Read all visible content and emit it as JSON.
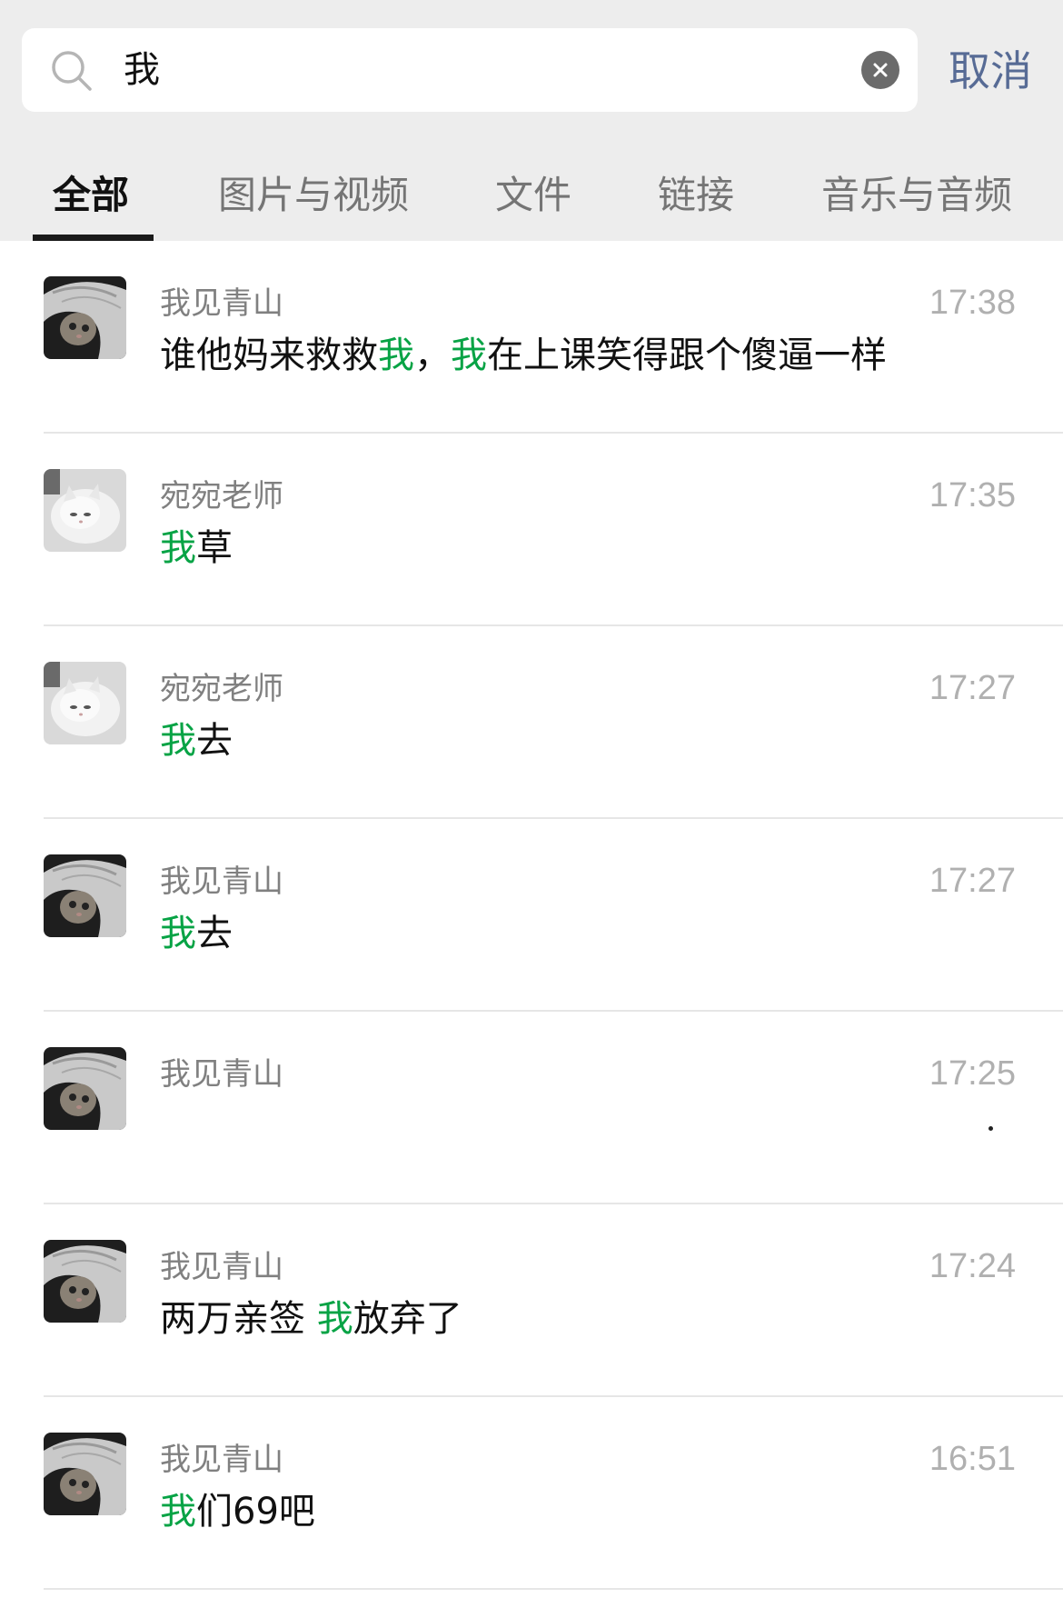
{
  "search": {
    "query": "我",
    "cancel_label": "取消"
  },
  "tabs": [
    {
      "label": "全部",
      "active": true
    },
    {
      "label": "图片与视频",
      "active": false
    },
    {
      "label": "文件",
      "active": false
    },
    {
      "label": "链接",
      "active": false
    },
    {
      "label": "音乐与音频",
      "active": false
    }
  ],
  "results": [
    {
      "sender": "我见青山",
      "time": "17:38",
      "avatar": "cat-under-blanket",
      "parts": [
        {
          "text": "谁他妈来救救",
          "hl": false
        },
        {
          "text": "我",
          "hl": true
        },
        {
          "text": "，",
          "hl": false
        },
        {
          "text": "我",
          "hl": true
        },
        {
          "text": "在上课笑得跟个傻逼一样",
          "hl": false
        }
      ]
    },
    {
      "sender": "宛宛老师",
      "time": "17:35",
      "avatar": "white-kitten",
      "parts": [
        {
          "text": "我",
          "hl": true
        },
        {
          "text": "草",
          "hl": false
        }
      ]
    },
    {
      "sender": "宛宛老师",
      "time": "17:27",
      "avatar": "white-kitten",
      "parts": [
        {
          "text": "我",
          "hl": true
        },
        {
          "text": "去",
          "hl": false
        }
      ]
    },
    {
      "sender": "我见青山",
      "time": "17:27",
      "avatar": "cat-under-blanket",
      "parts": [
        {
          "text": "我",
          "hl": true
        },
        {
          "text": "去",
          "hl": false
        }
      ]
    },
    {
      "sender": "我见青山",
      "time": "17:25",
      "avatar": "cat-under-blanket",
      "parts": []
    },
    {
      "sender": "我见青山",
      "time": "17:24",
      "avatar": "cat-under-blanket",
      "parts": [
        {
          "text": "两万亲签 ",
          "hl": false
        },
        {
          "text": "我",
          "hl": true
        },
        {
          "text": "放弃了",
          "hl": false
        }
      ]
    },
    {
      "sender": "我见青山",
      "time": "16:51",
      "avatar": "cat-under-blanket",
      "parts": [
        {
          "text": "我",
          "hl": true
        },
        {
          "text": "们69吧",
          "hl": false
        }
      ]
    }
  ],
  "colors": {
    "highlight": "#07a345",
    "link_blue": "#576b95",
    "header_bg": "#ededed"
  }
}
